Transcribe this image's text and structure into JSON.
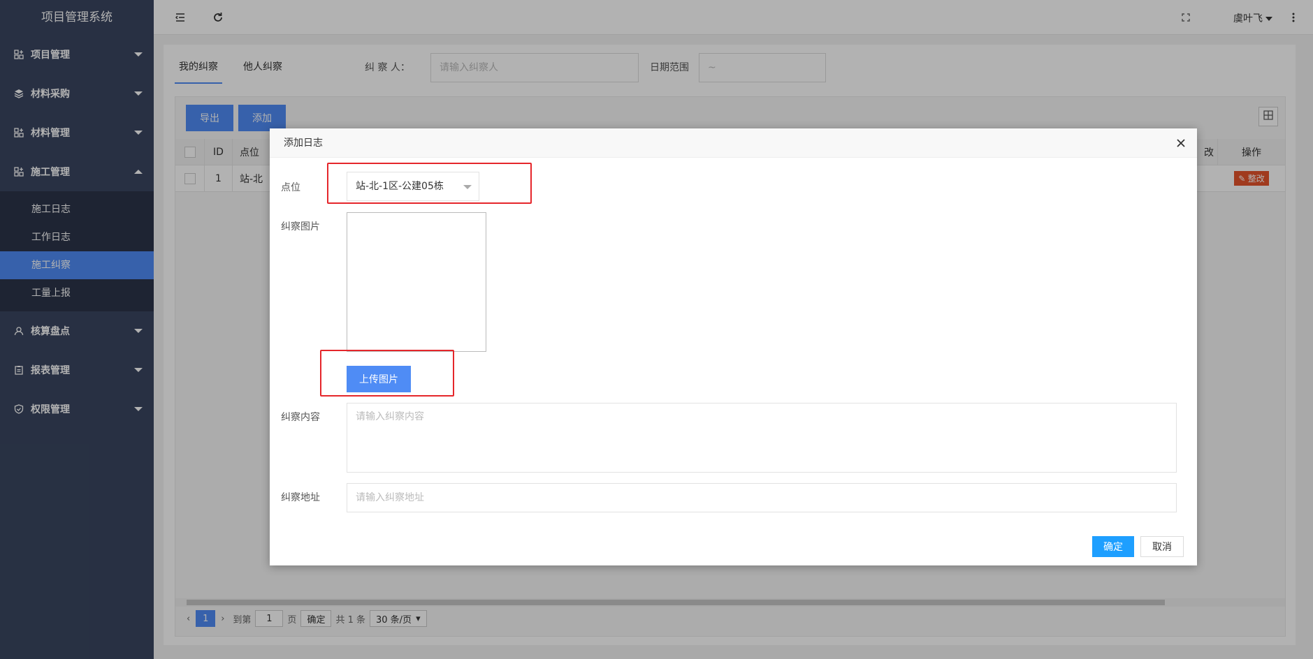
{
  "app": {
    "title": "项目管理系统"
  },
  "sidebar": {
    "items": [
      {
        "label": "项目管理",
        "icon": "grid-plus-icon",
        "expanded": false
      },
      {
        "label": "材料采购",
        "icon": "layers-icon",
        "expanded": false
      },
      {
        "label": "材料管理",
        "icon": "grid-plus-icon",
        "expanded": false
      },
      {
        "label": "施工管理",
        "icon": "grid-plus-icon",
        "expanded": true
      },
      {
        "label": "核算盘点",
        "icon": "user-icon",
        "expanded": false
      },
      {
        "label": "报表管理",
        "icon": "clipboard-icon",
        "expanded": false
      },
      {
        "label": "权限管理",
        "icon": "shield-icon",
        "expanded": false
      }
    ],
    "subitems": [
      "施工日志",
      "工作日志",
      "施工纠察",
      "工量上报"
    ],
    "active_subitem": "施工纠察"
  },
  "header": {
    "user": "虞叶飞"
  },
  "main": {
    "tabs": [
      "我的纠察",
      "他人纠察"
    ],
    "filter_inspector_label": "纠 察 人：",
    "filter_inspector_placeholder": "请输入纠察人",
    "filter_date_label": "日期范围",
    "filter_date_value": "~",
    "export_label": "导出",
    "add_label": "添加",
    "table": {
      "headers": [
        "ID",
        "点位",
        "改",
        "操作"
      ],
      "rows": [
        {
          "id": "1",
          "location": "站-北",
          "action": "整改"
        }
      ]
    },
    "pager": {
      "current": "1",
      "goto_label": "到第",
      "goto_value": "1",
      "page_unit": "页",
      "confirm_label": "确定",
      "total": "共 1 条",
      "page_size": "30 条/页"
    }
  },
  "modal": {
    "title": "添加日志",
    "location_label": "点位",
    "location_value": "站-北-1区-公建05栋",
    "image_label": "纠察图片",
    "upload_label": "上传图片",
    "content_label": "纠察内容",
    "content_placeholder": "请输入纠察内容",
    "address_label": "纠察地址",
    "address_placeholder": "请输入纠察地址",
    "ok_label": "确定",
    "cancel_label": "取消"
  },
  "colors": {
    "sidebar": "#3a4660",
    "accent": "#4f8cf5",
    "danger": "#e5542c",
    "highlight": "#e5262b"
  }
}
